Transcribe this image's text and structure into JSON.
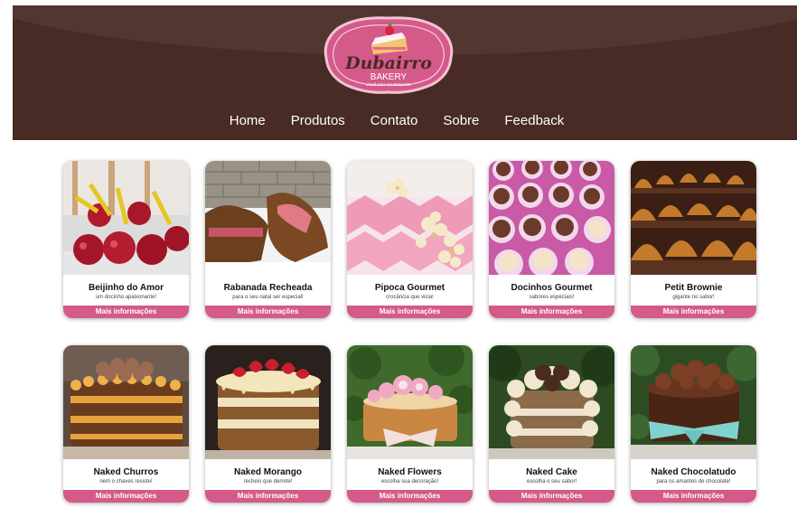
{
  "brand": {
    "name_line1": "Dubairro",
    "name_line2": "BAKERY",
    "tagline": "VOCÊ NÃO VAI RESISTIR!",
    "colors": {
      "header_bg": "#472b24",
      "badge": "#d45a8a",
      "button": "#d45a8a"
    }
  },
  "nav": {
    "items": [
      "Home",
      "Produtos",
      "Contato",
      "Sobre",
      "Feedback"
    ]
  },
  "products": [
    {
      "title": "Beijinho do Amor",
      "subtitle": "um docinho apaixonante!",
      "button": "Mais informações",
      "image": "candy-apples"
    },
    {
      "title": "Rabanada Recheada",
      "subtitle": "para o seu natal ser especial!",
      "button": "Mais informações",
      "image": "stuffed-french-toast"
    },
    {
      "title": "Pipoca Gourmet",
      "subtitle": "crocância que vicia!",
      "button": "Mais informações",
      "image": "gourmet-popcorn"
    },
    {
      "title": "Docinhos Gourmet",
      "subtitle": "sabores especiais!",
      "button": "Mais informações",
      "image": "gourmet-sweets"
    },
    {
      "title": "Petit Brownie",
      "subtitle": "gigante no sabor!",
      "button": "Mais informações",
      "image": "petit-brownie"
    },
    {
      "title": "Naked Churros",
      "subtitle": "nem o chaves resiste!",
      "button": "Mais informações",
      "image": "naked-churros-cake"
    },
    {
      "title": "Naked Morango",
      "subtitle": "recheio que derrete!",
      "button": "Mais informações",
      "image": "naked-strawberry-cake"
    },
    {
      "title": "Naked Flowers",
      "subtitle": "escolha sua decoração!",
      "button": "Mais informações",
      "image": "naked-flowers-cake"
    },
    {
      "title": "Naked Cake",
      "subtitle": "escolha o seu sabor!",
      "button": "Mais informações",
      "image": "naked-cake"
    },
    {
      "title": "Naked Chocolatudo",
      "subtitle": "para os amantes de chocolate!",
      "button": "Mais informações",
      "image": "naked-chocolate-cake"
    }
  ]
}
